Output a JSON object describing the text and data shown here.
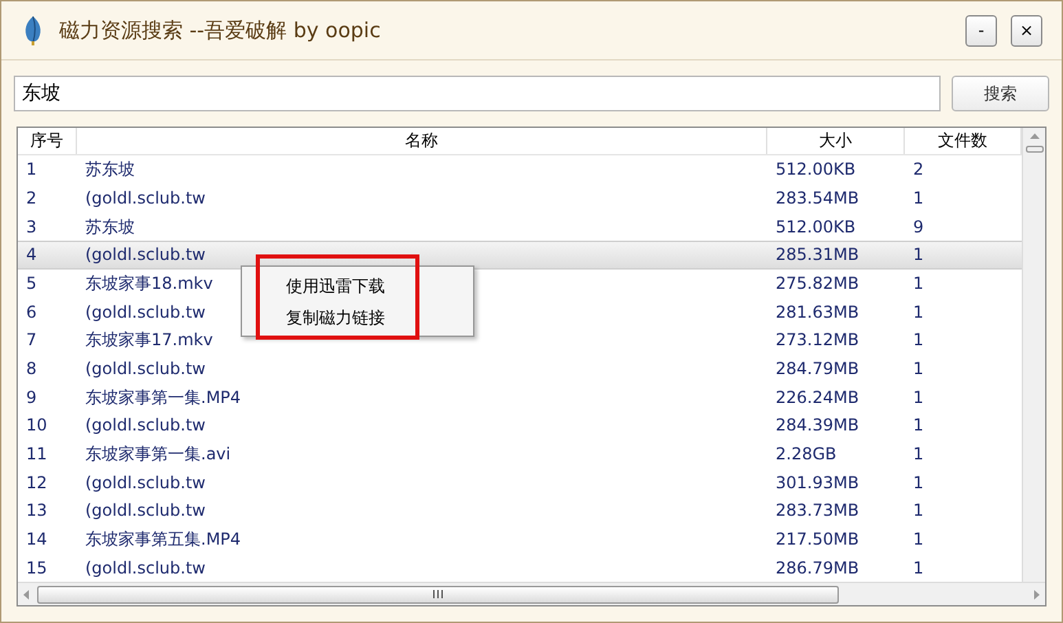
{
  "window": {
    "title": "磁力资源搜索 --吾爱破解 by oopic",
    "buttons": [
      "-",
      "×"
    ]
  },
  "search": {
    "value": "东坡",
    "button": "搜索"
  },
  "table": {
    "columns": [
      "序号",
      "名称",
      "大小",
      "文件数"
    ],
    "rows": [
      {
        "cells": [
          "1",
          "苏东坡",
          "512.00KB",
          "2"
        ],
        "selected": false
      },
      {
        "cells": [
          "2",
          "(goldl.sclub.tw",
          "283.54MB",
          "1"
        ],
        "selected": false
      },
      {
        "cells": [
          "3",
          "苏东坡",
          "512.00KB",
          "9"
        ],
        "selected": false
      },
      {
        "cells": [
          "4",
          "(goldl.sclub.tw",
          "285.31MB",
          "1"
        ],
        "selected": true
      },
      {
        "cells": [
          "5",
          "东坡家事18.mkv",
          "275.82MB",
          "1"
        ],
        "selected": false
      },
      {
        "cells": [
          "6",
          "(goldl.sclub.tw",
          "281.63MB",
          "1"
        ],
        "selected": false
      },
      {
        "cells": [
          "7",
          "东坡家事17.mkv",
          "273.12MB",
          "1"
        ],
        "selected": false
      },
      {
        "cells": [
          "8",
          "(goldl.sclub.tw",
          "284.79MB",
          "1"
        ],
        "selected": false
      },
      {
        "cells": [
          "9",
          "东坡家事第一集.MP4",
          "226.24MB",
          "1"
        ],
        "selected": false
      },
      {
        "cells": [
          "10",
          "(goldl.sclub.tw",
          "284.39MB",
          "1"
        ],
        "selected": false
      },
      {
        "cells": [
          "11",
          "东坡家事第一集.avi",
          "2.28GB",
          "1"
        ],
        "selected": false
      },
      {
        "cells": [
          "12",
          "(goldl.sclub.tw",
          "301.93MB",
          "1"
        ],
        "selected": false
      },
      {
        "cells": [
          "13",
          "(goldl.sclub.tw",
          "283.73MB",
          "1"
        ],
        "selected": false
      },
      {
        "cells": [
          "14",
          "东坡家事第五集.MP4",
          "217.50MB",
          "1"
        ],
        "selected": false
      },
      {
        "cells": [
          "15",
          "(goldl.sclub.tw",
          "286.79MB",
          "1"
        ],
        "selected": false
      }
    ]
  },
  "context_menu": {
    "items": [
      "使用迅雷下载",
      "复制磁力链接"
    ],
    "highlighted": true
  }
}
